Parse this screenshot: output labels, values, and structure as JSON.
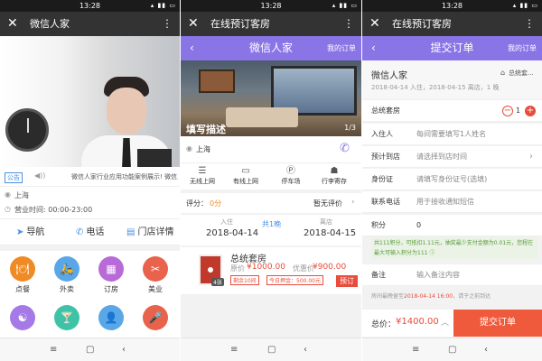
{
  "status": {
    "time1": "13:28",
    "time2": "13:28",
    "time3": "13:28"
  },
  "p1": {
    "title": "微信人家",
    "notice_tag": "公告",
    "notice_text": "微信人家行业应用功能案例展示! 微信人家",
    "location": "上海",
    "hours": "营业时间: 00:00-23:00",
    "actions": [
      {
        "label": "导航",
        "icon": "➤"
      },
      {
        "label": "电话",
        "icon": "✆"
      },
      {
        "label": "门店详情",
        "icon": "▤"
      }
    ],
    "grid": [
      {
        "label": "点餐",
        "icon": "🍽",
        "color": "#f08a24"
      },
      {
        "label": "外卖",
        "icon": "🛵",
        "color": "#5aa7e8"
      },
      {
        "label": "订房",
        "icon": "▦",
        "color": "#b86ad6"
      },
      {
        "label": "美业",
        "icon": "✂",
        "color": "#e8624c"
      },
      {
        "label": "",
        "icon": "☯",
        "color": "#a57ae6"
      },
      {
        "label": "",
        "icon": "🍸",
        "color": "#3fc3a6"
      },
      {
        "label": "",
        "icon": "👤",
        "color": "#5aa7e8"
      },
      {
        "label": "",
        "icon": "🎤",
        "color": "#e8624c"
      }
    ]
  },
  "p2": {
    "title": "在线预订客房",
    "bar_title": "微信人家",
    "my_orders": "我的订单",
    "img_caption": "填写描述",
    "img_counter": "1/3",
    "location": "上海",
    "amenities": [
      {
        "label": "无线上网",
        "icon": "☰"
      },
      {
        "label": "有线上网",
        "icon": "▭"
      },
      {
        "label": "停车场",
        "icon": "Ⓟ"
      },
      {
        "label": "行李寄存",
        "icon": "☗"
      }
    ],
    "rating_label": "评分：",
    "rating_value": "0分",
    "no_review": "暂无评价",
    "checkin_label": "入住",
    "checkin_date": "2018-04-14",
    "nights": "共1晚",
    "checkout_label": "离店",
    "checkout_date": "2018-04-15",
    "room_name": "总统套房",
    "orig_price_label": "原价",
    "orig_price": "¥1000.00",
    "sale_price_label": "优惠价",
    "sale_price": "¥900.00",
    "tag1": "剩余10间",
    "tag2": "今日押金：500.00元",
    "book_btn": "预订",
    "count": "4张"
  },
  "p3": {
    "title": "在线预订客房",
    "bar_title": "提交订单",
    "my_orders": "我的订单",
    "hotel": "微信人家",
    "room_short": "总统套...",
    "stay_info": "2018-04-14 入住，2018-04-15 离店，1 晚",
    "room_label": "总统套房",
    "room_qty": "1",
    "fields": [
      {
        "label": "入住人",
        "value": "每间需要填写1人姓名"
      },
      {
        "label": "预计到店",
        "value": "请选择到店时间"
      },
      {
        "label": "身份证",
        "value": "请填写身份证号(选填)"
      },
      {
        "label": "联系电话",
        "value": "用于接收通知短信"
      }
    ],
    "points_label": "积分",
    "points_value": "0",
    "points_note": "共111积分，可抵扣1.11元，抽奖最少支付金额为0.01元，您程在最大可输入积分为111 ⓘ",
    "remark_label": "备注",
    "remark_placeholder": "输入备注内容",
    "keep_note_a": "房间最晚留至",
    "keep_note_time": "2018-04-14 16:00",
    "keep_note_b": "，请于之前到达",
    "total_label": "总价：",
    "total_value": "¥1400.00",
    "submit": "提交订单"
  },
  "colors": {
    "purple": "#8a75e6",
    "red": "#f05a3c",
    "blue": "#4a90e2"
  }
}
